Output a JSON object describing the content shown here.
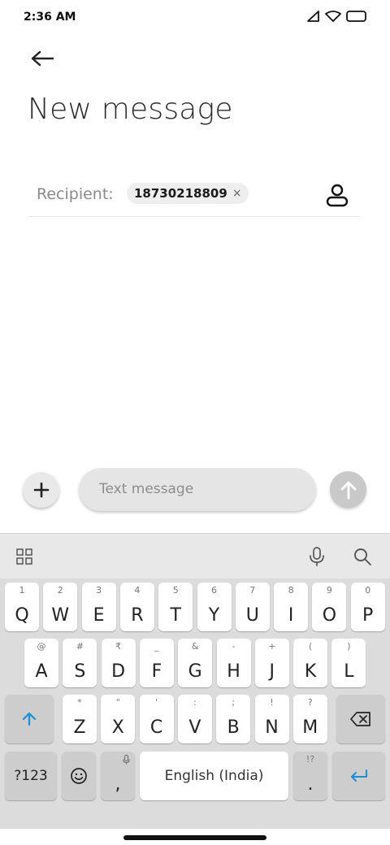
{
  "status_bar": {
    "time": "2:36 AM"
  },
  "header": {
    "title": "New message"
  },
  "recipient": {
    "label": "Recipient:",
    "chip_number": "18730218809",
    "chip_remove": "×"
  },
  "compose": {
    "placeholder": "Text message"
  },
  "keyboard": {
    "row1": [
      {
        "hint": "1",
        "key": "Q"
      },
      {
        "hint": "2",
        "key": "W"
      },
      {
        "hint": "3",
        "key": "E"
      },
      {
        "hint": "4",
        "key": "R"
      },
      {
        "hint": "5",
        "key": "T"
      },
      {
        "hint": "6",
        "key": "Y"
      },
      {
        "hint": "7",
        "key": "U"
      },
      {
        "hint": "8",
        "key": "I"
      },
      {
        "hint": "9",
        "key": "O"
      },
      {
        "hint": "0",
        "key": "P"
      }
    ],
    "row2": [
      {
        "hint": "@",
        "key": "A"
      },
      {
        "hint": "#",
        "key": "S"
      },
      {
        "hint": "₹",
        "key": "D"
      },
      {
        "hint": "_",
        "key": "F"
      },
      {
        "hint": "&",
        "key": "G"
      },
      {
        "hint": "-",
        "key": "H"
      },
      {
        "hint": "+",
        "key": "J"
      },
      {
        "hint": "(",
        "key": "K"
      },
      {
        "hint": ")",
        "key": "L"
      }
    ],
    "row3": [
      {
        "hint": "*",
        "key": "Z"
      },
      {
        "hint": "\"",
        "key": "X"
      },
      {
        "hint": "'",
        "key": "C"
      },
      {
        "hint": ":",
        "key": "V"
      },
      {
        "hint": ";",
        "key": "B"
      },
      {
        "hint": "!",
        "key": "N"
      },
      {
        "hint": "?",
        "key": "M"
      }
    ],
    "symbols_label": "?123",
    "comma": ",",
    "space_label": "English (India)",
    "period": ".",
    "period_hint": "!?",
    "accent_color": "#1a8fd8"
  }
}
